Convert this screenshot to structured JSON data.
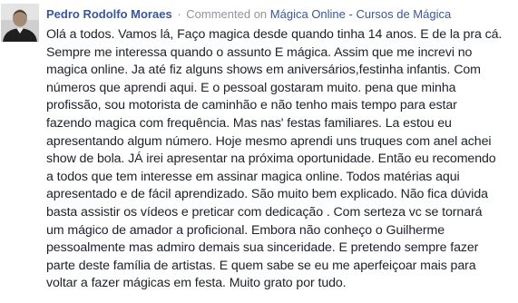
{
  "comment": {
    "author": "Pedro Rodolfo Moraes",
    "separator": "·",
    "meta_prefix": "Commented on",
    "source": "Mágica Online - Cursos de Mágica",
    "avatar_icon": "user-profile-photo",
    "lines": [
      "Olá a todos. Vamos lá, Faço magica desde quando tinha 14 anos. E de la pra cá.",
      "Sempre me interessa quando o assunto E mágica. Assim que me increvi no",
      "magica online. Ja até fiz alguns shows em aniversários,festinha infantis. Com",
      "números que aprendi aqui. E o pessoal gostaram muito. pena que minha",
      "profissão, sou motorista de caminhão e não tenho mais tempo para estar",
      "fazendo magica com frequência. Mas nas' festas familiares. La estou eu",
      "apresentando algum número. Hoje mesmo aprendi uns truques com anel achei",
      "show de bola. JÁ irei apresentar na próxima oportunidade. Então eu recomendo",
      "a todos que tem interesse em assinar magica online. Todos matérias aqui",
      "apresentado e de fácil aprendizado. São muito bem explicado. Não fica dúvida",
      "basta assistir os vídeos e preticar com dedicação . Com serteza vc se tornará",
      "um mágico de amador a proficional. Embora não conheço o Guilherme",
      "pessoalmente mas admiro demais sua sinceridade. E pretendo sempre fazer",
      "parte deste família de artistas. E quem sabe se eu me aperfeiçoar mais para",
      "voltar a fazer mágicas em festa. Muito grato por tudo."
    ]
  }
}
